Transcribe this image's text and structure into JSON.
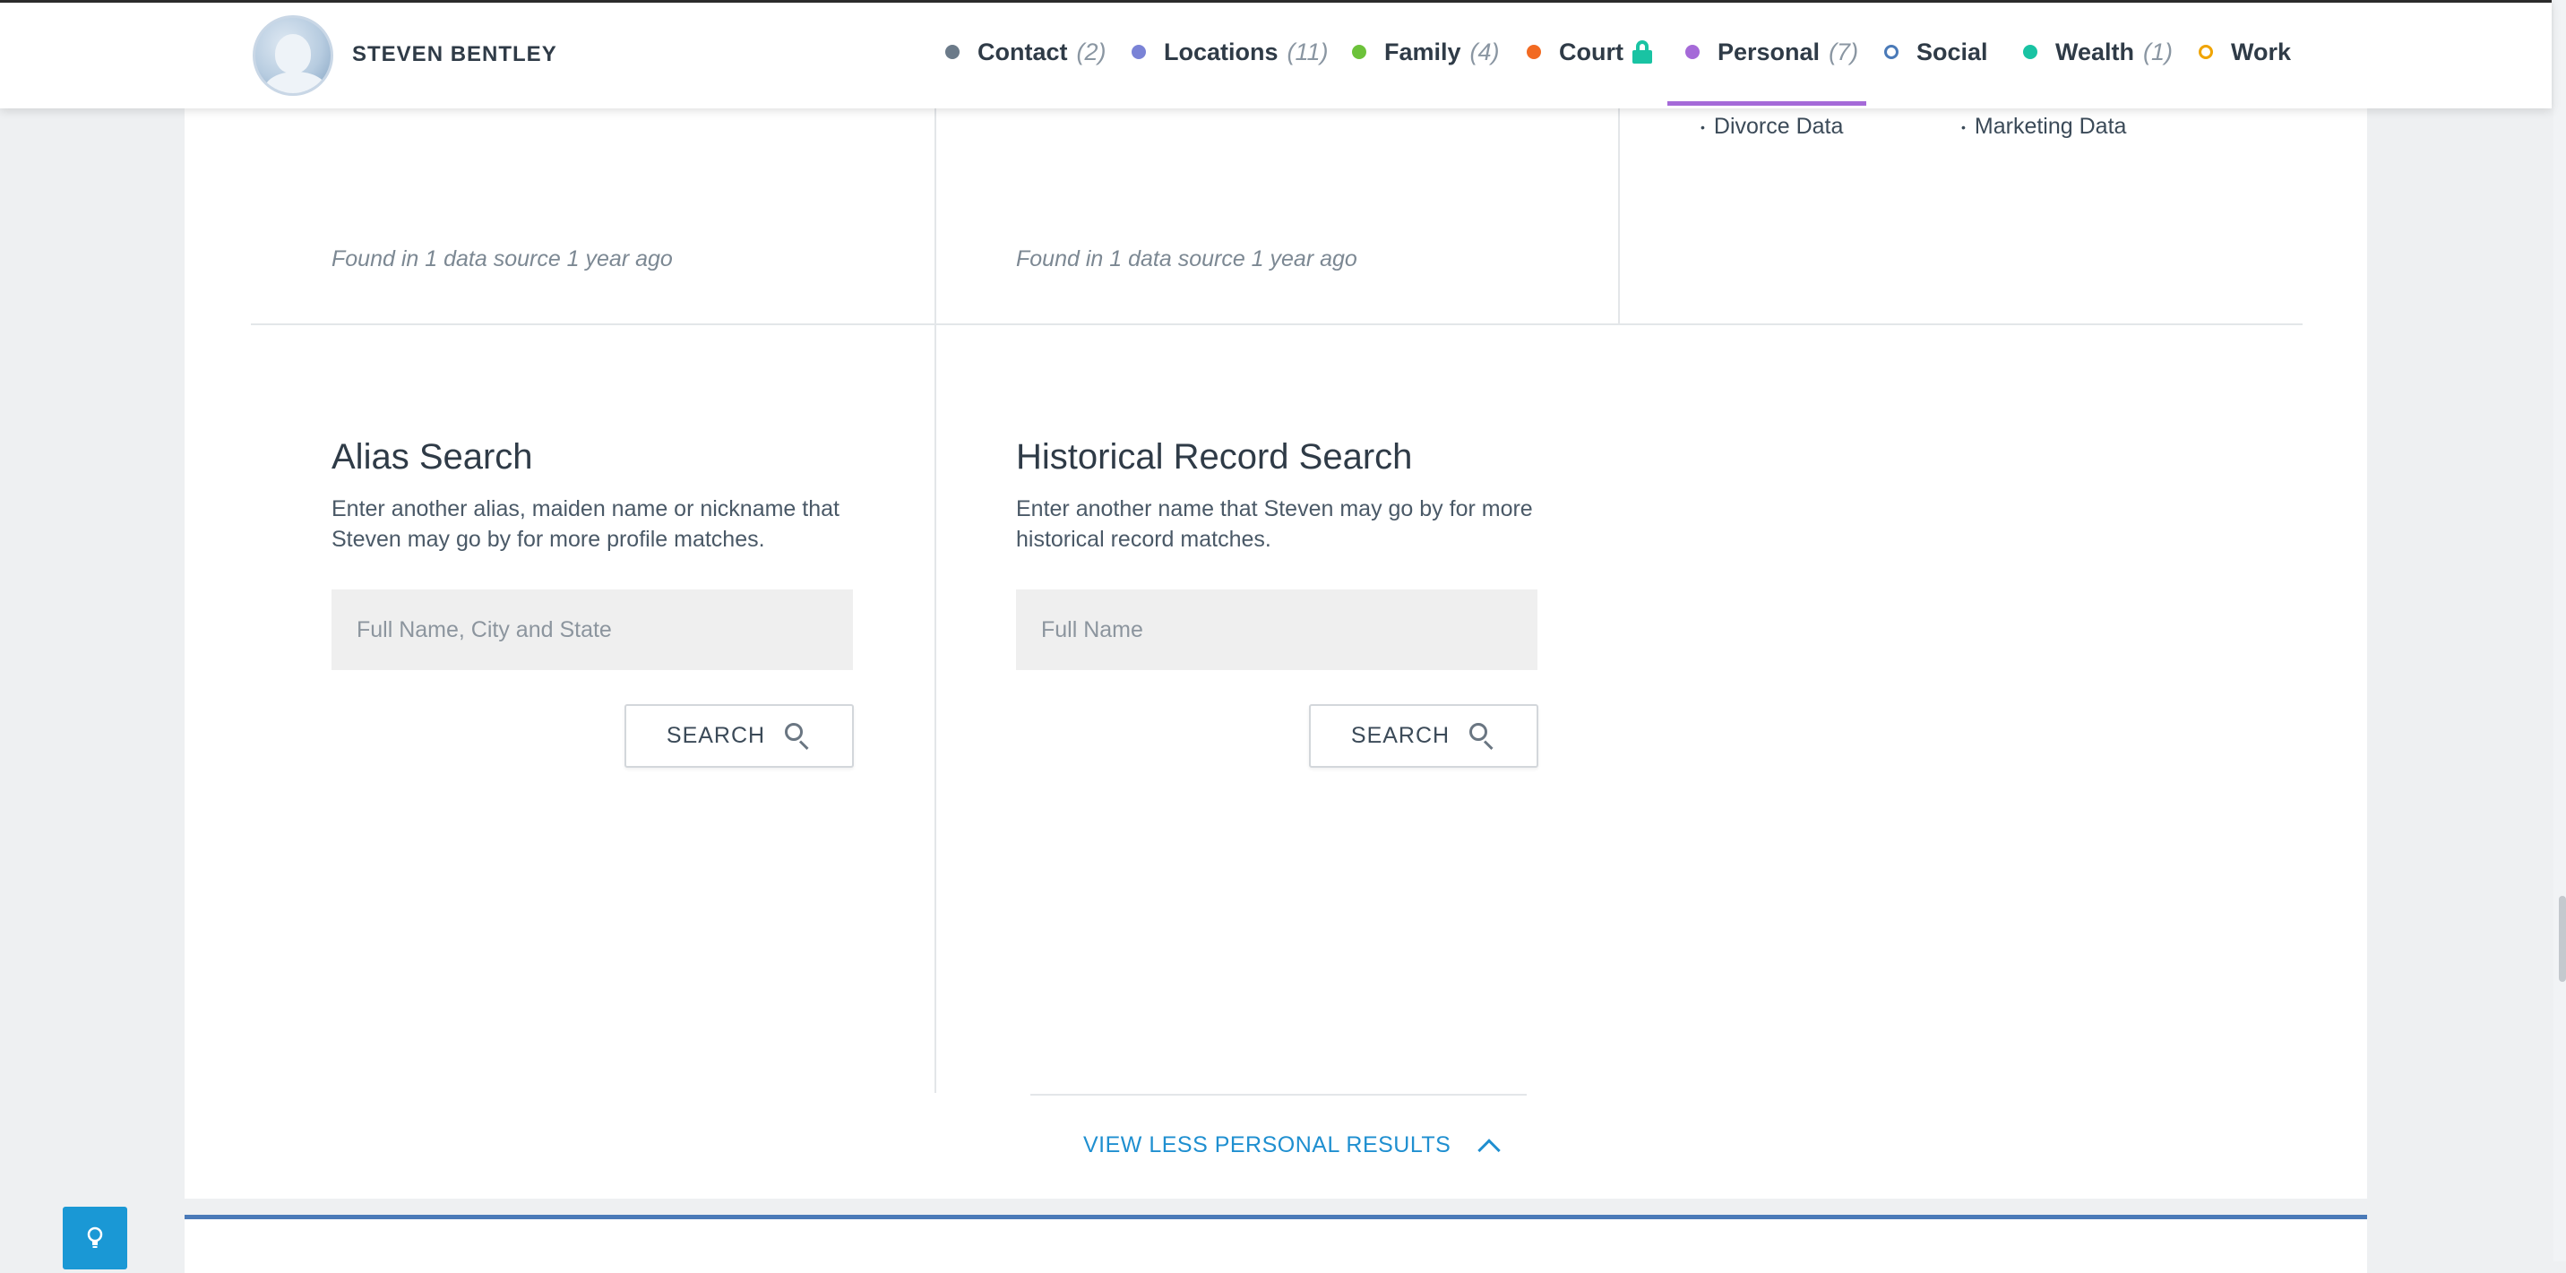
{
  "header": {
    "person_name": "STEVEN BENTLEY",
    "nav": [
      {
        "label": "Contact",
        "count": "(2)",
        "color": "#6b7a89",
        "style": "filled"
      },
      {
        "label": "Locations",
        "count": "(11)",
        "color": "#7a83d6",
        "style": "filled"
      },
      {
        "label": "Family",
        "count": "(4)",
        "color": "#6cc23a",
        "style": "filled"
      },
      {
        "label": "Court",
        "count": "",
        "color": "#f26a22",
        "style": "filled",
        "icon": "lock-icon"
      },
      {
        "label": "Personal",
        "count": "(7)",
        "color": "#a56ad8",
        "style": "filled",
        "active": true
      },
      {
        "label": "Social",
        "count": "",
        "color": "#4a7ab8",
        "style": "outline"
      },
      {
        "label": "Wealth",
        "count": "(1)",
        "color": "#19c3a3",
        "style": "filled"
      },
      {
        "label": "Work",
        "count": "",
        "color": "#f0a400",
        "style": "outline"
      }
    ]
  },
  "top_row": {
    "col1_found": "Found in 1 data source 1 year ago",
    "col2_found": "Found in 1 data source 1 year ago",
    "col3_items": [
      "Divorce Data",
      "Marketing Data"
    ]
  },
  "alias_search": {
    "title": "Alias Search",
    "description": "Enter another alias, maiden name or nickname that Steven may go by for more profile matches.",
    "placeholder": "Full Name, City and State",
    "button": "SEARCH"
  },
  "historical_search": {
    "title": "Historical Record Search",
    "description": "Enter another name that Steven may go by for more historical record matches.",
    "placeholder": "Full Name",
    "button": "SEARCH"
  },
  "view_less_label": "VIEW LESS PERSONAL RESULTS"
}
